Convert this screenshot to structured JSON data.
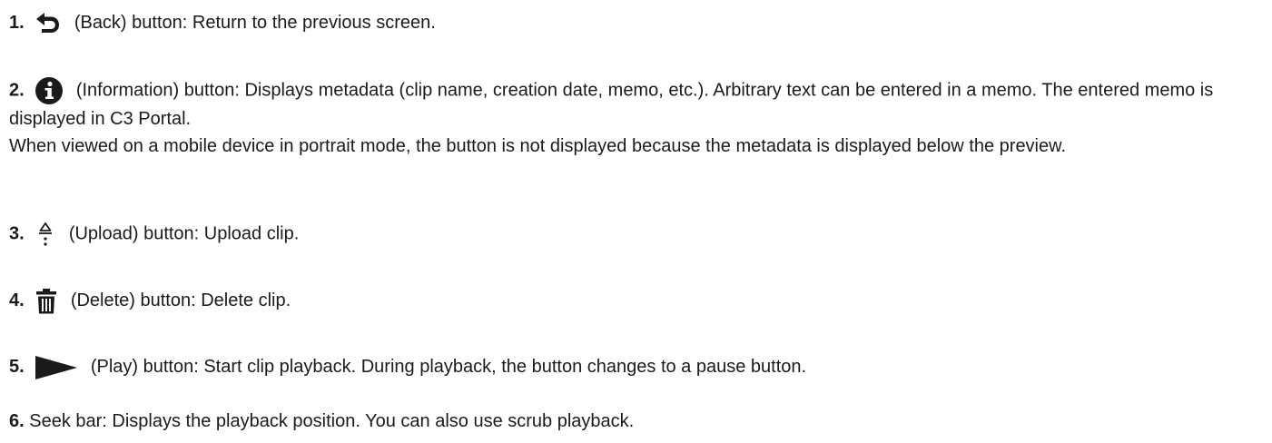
{
  "items": [
    {
      "number": "1.",
      "icon": "back-icon",
      "text": "(Back) button: Return to the previous screen."
    },
    {
      "number": "2.",
      "icon": "information-icon",
      "text": "(Information) button: Displays metadata (clip name, creation date, memo, etc.). Arbitrary text can be entered in a memo. The entered memo is displayed in C3 Portal.",
      "text2": "When viewed on a mobile device in portrait mode, the button is not displayed because the metadata is displayed below the preview."
    },
    {
      "number": "3.",
      "icon": "upload-icon",
      "text": "(Upload) button: Upload clip."
    },
    {
      "number": "4.",
      "icon": "trash-icon",
      "text": "(Delete) button: Delete clip."
    },
    {
      "number": "5.",
      "icon": "play-icon",
      "text": "(Play) button: Start clip playback. During playback, the button changes to a pause button."
    },
    {
      "number": "6.",
      "text": "Seek bar: Displays the playback position. You can also use scrub playback."
    }
  ],
  "colors": {
    "text": "#1a1a1a",
    "icon": "#1a1a1a"
  }
}
